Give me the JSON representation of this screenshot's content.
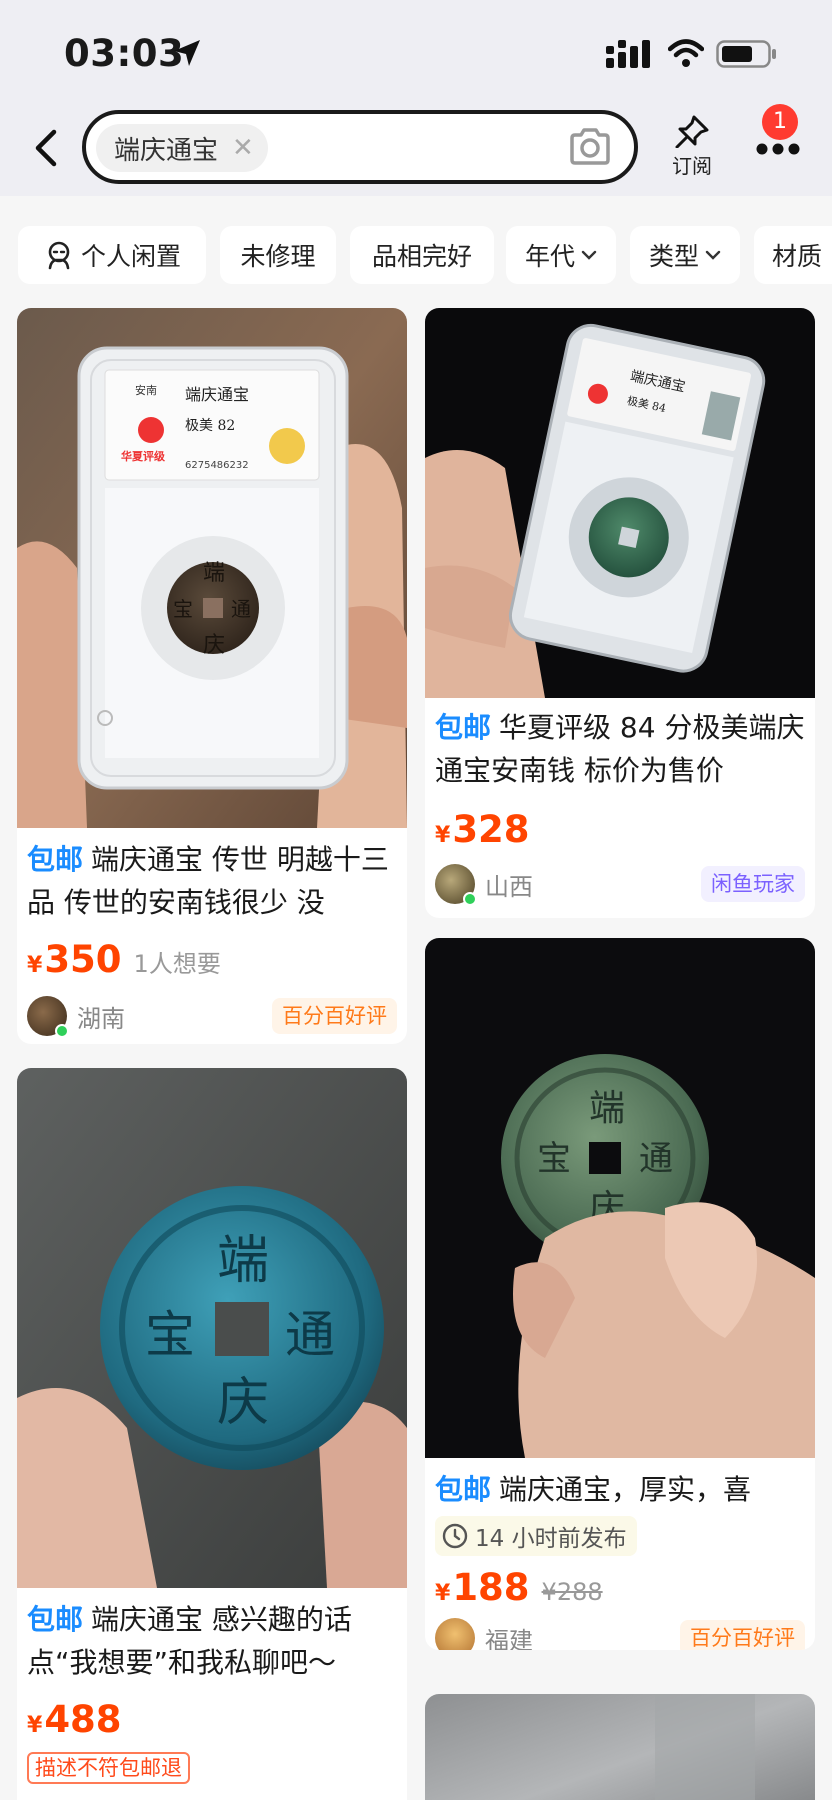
{
  "status_bar": {
    "time": "03:03"
  },
  "search": {
    "query": "端庆通宝"
  },
  "header": {
    "subscribe_label": "订阅",
    "badge_count": "1"
  },
  "filters": [
    {
      "label": "个人闲置",
      "icon": "person-icon"
    },
    {
      "label": "未修理"
    },
    {
      "label": "品相完好"
    },
    {
      "label": "年代",
      "dropdown": true
    },
    {
      "label": "类型",
      "dropdown": true
    },
    {
      "label": "材质"
    }
  ],
  "products": [
    {
      "free_shipping": "包邮",
      "title": "端庆通宝 传世 明越十三品 传世的安南钱很少 没",
      "currency": "¥",
      "price": "350",
      "want": "1人想要",
      "location": "湖南",
      "tag": "百分百好评"
    },
    {
      "free_shipping": "包邮",
      "title": "华夏评级 84 分极美端庆通宝安南钱 标价为售价",
      "currency": "¥",
      "price": "328",
      "location": "山西",
      "tag": "闲鱼玩家"
    },
    {
      "free_shipping": "包邮",
      "title": "端庆通宝 感兴趣的话点“我想要”和我私聊吧～",
      "currency": "¥",
      "price": "488",
      "refund_tag": "描述不符包邮退"
    },
    {
      "free_shipping": "包邮",
      "title": "端庆通宝，厚实，喜",
      "posted": "14 小时前发布",
      "currency": "¥",
      "price": "188",
      "old_price": "¥288",
      "location": "福建",
      "tag": "百分百好评"
    }
  ],
  "slab_label": {
    "region": "安南",
    "name": "端庆通宝",
    "grade": "极美 82",
    "brand": "华夏评级",
    "cert": "6275486232",
    "grade2": "极美 84"
  },
  "colors": {
    "accent_blue": "#1a8cff",
    "price_red": "#ff4400",
    "badge_red": "#ff3b30"
  }
}
